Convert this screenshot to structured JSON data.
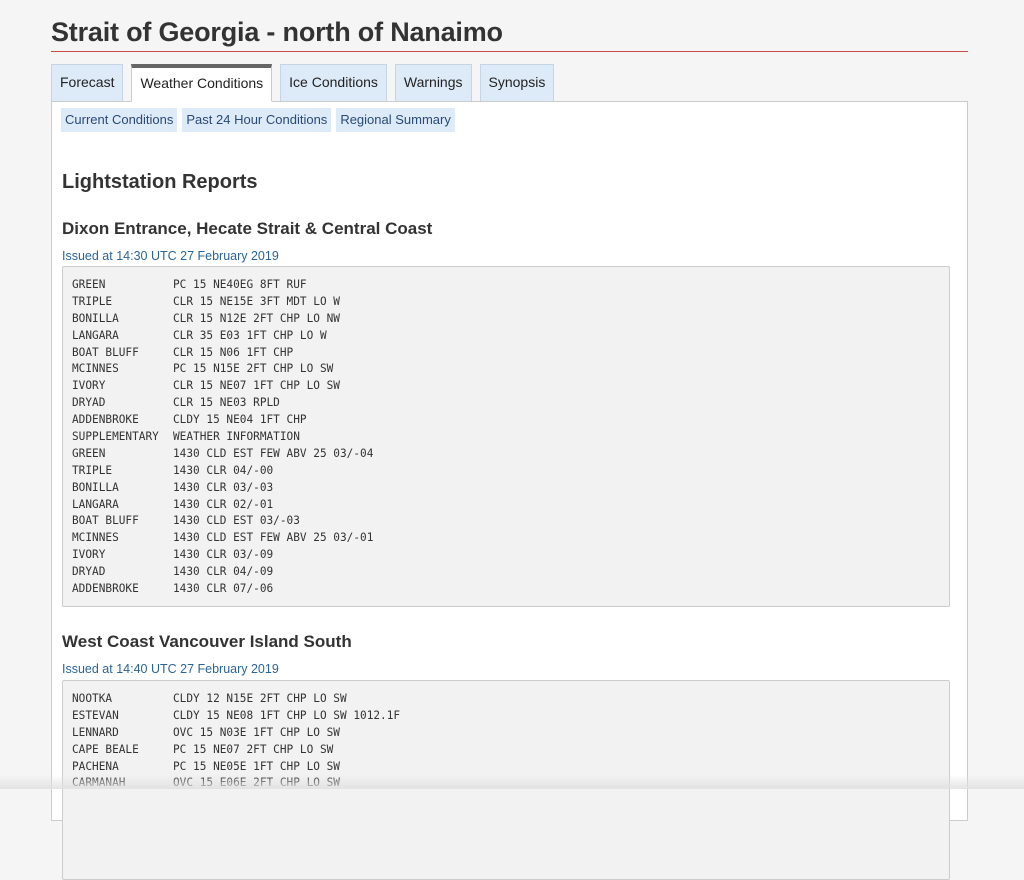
{
  "page": {
    "title": "Strait of Georgia - north of Nanaimo"
  },
  "tabs": [
    {
      "label": "Forecast",
      "active": false
    },
    {
      "label": "Weather Conditions",
      "active": true
    },
    {
      "label": "Ice Conditions",
      "active": false
    },
    {
      "label": "Warnings",
      "active": false
    },
    {
      "label": "Synopsis",
      "active": false
    }
  ],
  "subtabs": [
    {
      "label": "Current Conditions"
    },
    {
      "label": "Past 24 Hour Conditions"
    },
    {
      "label": "Regional Summary"
    }
  ],
  "section_title": "Lightstation Reports",
  "reports": [
    {
      "title": "Dixon Entrance, Hecate Strait & Central Coast",
      "issued": "Issued at 14:30 UTC 27 February 2019",
      "lines": [
        {
          "station": "GREEN",
          "obs": "PC 15 NE40EG 8FT RUF"
        },
        {
          "station": "TRIPLE",
          "obs": "CLR 15 NE15E 3FT MDT LO W"
        },
        {
          "station": "BONILLA",
          "obs": "CLR 15 N12E 2FT CHP LO NW"
        },
        {
          "station": "LANGARA",
          "obs": "CLR 35 E03 1FT CHP LO W"
        },
        {
          "station": "BOAT BLUFF",
          "obs": "CLR 15 N06 1FT CHP"
        },
        {
          "station": "MCINNES",
          "obs": "PC 15 N15E 2FT CHP LO SW"
        },
        {
          "station": "IVORY",
          "obs": "CLR 15 NE07 1FT CHP LO SW"
        },
        {
          "station": "DRYAD",
          "obs": "CLR 15 NE03 RPLD"
        },
        {
          "station": "ADDENBROKE",
          "obs": "CLDY 15 NE04 1FT CHP"
        },
        {
          "station": "SUPPLEMENTARY",
          "obs": "WEATHER INFORMATION"
        },
        {
          "station": "GREEN",
          "obs": "1430 CLD EST FEW ABV 25 03/-04"
        },
        {
          "station": "TRIPLE",
          "obs": "1430 CLR 04/-00"
        },
        {
          "station": "BONILLA",
          "obs": "1430 CLR 03/-03"
        },
        {
          "station": "LANGARA",
          "obs": "1430 CLR 02/-01"
        },
        {
          "station": "BOAT BLUFF",
          "obs": "1430 CLD EST 03/-03"
        },
        {
          "station": "MCINNES",
          "obs": "1430 CLD EST FEW ABV 25 03/-01"
        },
        {
          "station": "IVORY",
          "obs": "1430 CLR 03/-09"
        },
        {
          "station": "DRYAD",
          "obs": "1430 CLR 04/-09"
        },
        {
          "station": "ADDENBROKE",
          "obs": "1430 CLR 07/-06"
        }
      ]
    },
    {
      "title": "West Coast Vancouver Island South",
      "issued": "Issued at 14:40 UTC 27 February 2019",
      "lines": [
        {
          "station": "NOOTKA",
          "obs": "CLDY 12 N15E 2FT CHP LO SW"
        },
        {
          "station": "ESTEVAN",
          "obs": "CLDY 15 NE08 1FT CHP LO SW 1012.1F"
        },
        {
          "station": "LENNARD",
          "obs": "OVC 15 N03E 1FT CHP LO SW"
        },
        {
          "station": "CAPE BEALE",
          "obs": "PC 15 NE07 2FT CHP LO SW"
        },
        {
          "station": "PACHENA",
          "obs": "PC 15 NE05E 1FT CHP LO SW"
        },
        {
          "station": "CARMANAH",
          "obs": "OVC 15 E06E 2FT CHP LO SW"
        }
      ]
    }
  ]
}
